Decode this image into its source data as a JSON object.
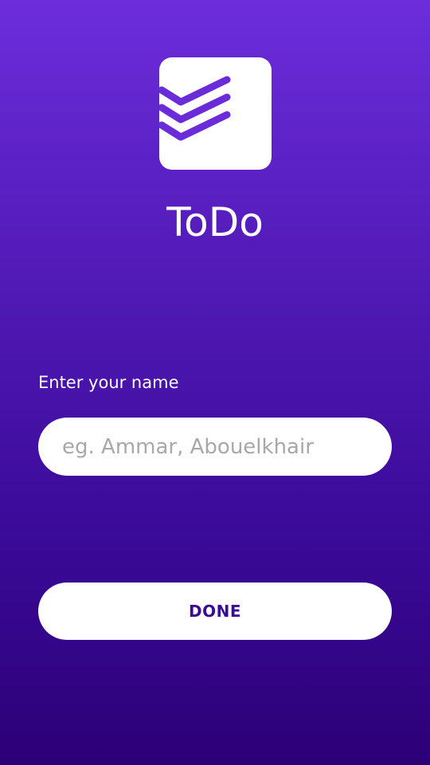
{
  "app": {
    "title": "ToDo",
    "logo_icon": "stacked-chevrons-icon",
    "accent_color": "#6a2bd8"
  },
  "form": {
    "name_label": "Enter your name",
    "name_placeholder": "eg. Ammar, Abouelkhair",
    "name_value": ""
  },
  "actions": {
    "done_label": "DONE"
  }
}
